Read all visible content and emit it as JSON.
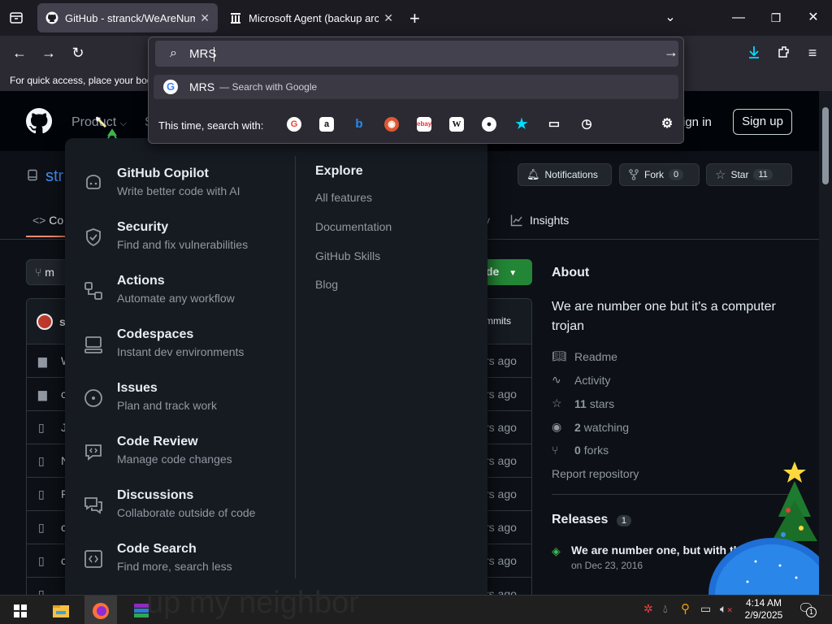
{
  "browser": {
    "tabs": [
      {
        "title": "GitHub - stranck/WeAreNumberOne",
        "active": true
      },
      {
        "title": "Microsoft Agent (backup archive)",
        "active": false
      }
    ],
    "url_value": "MRS",
    "bookmarks_text": "For quick access, place your boo",
    "suggestion": {
      "query": "MRS",
      "suffix": "— Search with Google"
    },
    "search_with_label": "This time, search with:"
  },
  "gh": {
    "nav": {
      "product": "Product",
      "sign_in": "Sign in",
      "sign_up": "Sign up"
    },
    "repo_fragment": "str",
    "actions": {
      "notifications": "Notifications",
      "fork_label": "Fork",
      "fork_count": "0",
      "star_label": "Star",
      "star_count": "11"
    },
    "tabs": {
      "code": "Co",
      "insights": "Insights",
      "y": "y"
    },
    "branch_fragment": "m",
    "code_button": "de",
    "commits_fragment": "mmits",
    "file_rows": [
      {
        "ago": "rs ago"
      },
      {
        "ago": "rs ago"
      },
      {
        "ago": "rs ago"
      },
      {
        "ago": "rs ago"
      },
      {
        "ago": "rs ago"
      },
      {
        "ago": "rs ago"
      },
      {
        "ago": "rs ago"
      },
      {
        "ago": "rs ago"
      }
    ],
    "file_initials": [
      "W",
      "c",
      "J",
      "N",
      "F",
      "c",
      "c"
    ],
    "about": {
      "title": "About",
      "description": "We are number one but it's a computer trojan",
      "readme": "Readme",
      "activity": "Activity",
      "stars_n": "11",
      "stars_l": "stars",
      "watching_n": "2",
      "watching_l": "watching",
      "forks_n": "0",
      "forks_l": "forks",
      "report": "Report repository"
    },
    "releases": {
      "title": "Releases",
      "count": "1",
      "name": "We are number one, but with thi",
      "date": "on Dec 23, 2016"
    }
  },
  "menu": {
    "items": [
      {
        "title": "GitHub Copilot",
        "desc": "Write better code with AI",
        "icon": "copilot-icon"
      },
      {
        "title": "Security",
        "desc": "Find and fix vulnerabilities",
        "icon": "shield-icon"
      },
      {
        "title": "Actions",
        "desc": "Automate any workflow",
        "icon": "workflow-icon"
      },
      {
        "title": "Codespaces",
        "desc": "Instant dev environments",
        "icon": "codespaces-icon"
      },
      {
        "title": "Issues",
        "desc": "Plan and track work",
        "icon": "issue-icon"
      },
      {
        "title": "Code Review",
        "desc": "Manage code changes",
        "icon": "code-review-icon"
      },
      {
        "title": "Discussions",
        "desc": "Collaborate outside of code",
        "icon": "discussion-icon"
      },
      {
        "title": "Code Search",
        "desc": "Find more, search less",
        "icon": "code-search-icon"
      }
    ],
    "explore_title": "Explore",
    "explore": [
      "All features",
      "Documentation",
      "GitHub Skills",
      "Blog"
    ]
  },
  "taskbar": {
    "time": "4:14 AM",
    "date": "2/9/2025",
    "notif_count": "1",
    "wallpaper_text": "up my neighbor"
  },
  "colors": {
    "accent_green": "#238636",
    "link_blue": "#4493f8",
    "tab_active": "#42414d"
  }
}
